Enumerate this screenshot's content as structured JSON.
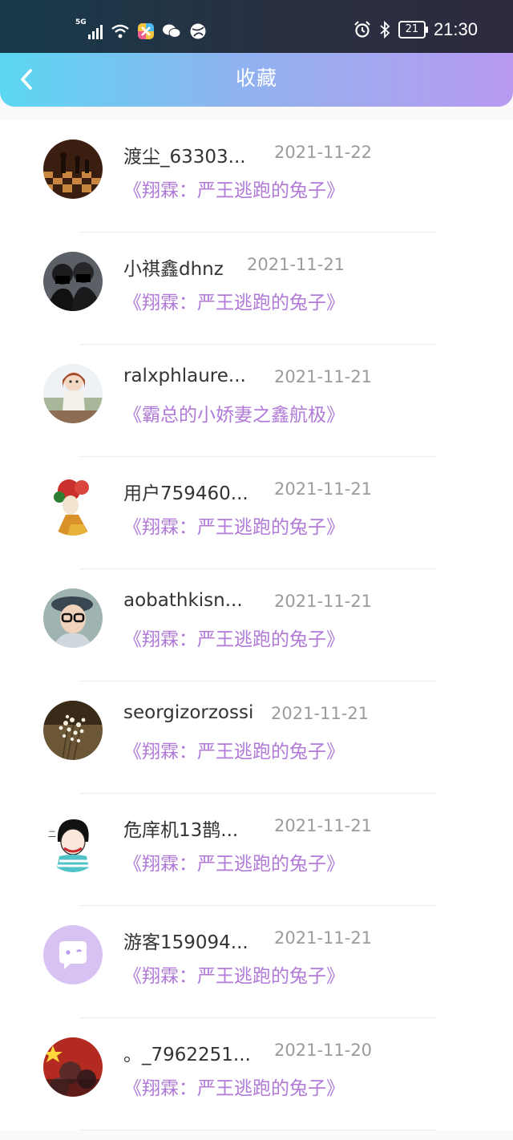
{
  "status_bar": {
    "network": "5G",
    "battery": "21",
    "time": "21:30"
  },
  "header": {
    "title": "收藏"
  },
  "items": [
    {
      "name": "渡尘_63303...",
      "date": "2021-11-22",
      "book": "《翔霖：严王逃跑的兔子》",
      "avatar": "chess-avatar"
    },
    {
      "name": "小祺鑫dhnz",
      "date": "2021-11-21",
      "book": "《翔霖：严王逃跑的兔子》",
      "avatar": "masked-people-avatar"
    },
    {
      "name": "ralxphlaure...",
      "date": "2021-11-21",
      "book": "《霸总的小娇妻之鑫航极》",
      "avatar": "doll-avatar"
    },
    {
      "name": "用户759460...",
      "date": "2021-11-21",
      "book": "《翔霖：严王逃跑的兔子》",
      "avatar": "flower-girl-avatar"
    },
    {
      "name": "aobathkisn...",
      "date": "2021-11-21",
      "book": "《翔霖：严王逃跑的兔子》",
      "avatar": "kid-glasses-avatar"
    },
    {
      "name": "seorgizorzossi",
      "date": "2021-11-21",
      "book": "《翔霖：严王逃跑的兔子》",
      "avatar": "baby-breath-avatar"
    },
    {
      "name": "危庠机13鹊...",
      "date": "2021-11-21",
      "book": "《翔霖：严王逃跑的兔子》",
      "avatar": "cartoon-girl-avatar"
    },
    {
      "name": "游客159094...",
      "date": "2021-11-21",
      "book": "《翔霖：严王逃跑的兔子》",
      "avatar": "chat-bubble-avatar"
    },
    {
      "name": "。_7962251...",
      "date": "2021-11-20",
      "book": "《翔霖：严王逃跑的兔子》",
      "avatar": "flag-avatar"
    }
  ],
  "colors": {
    "accent_purple": "#b17ad8",
    "header_start": "#5bd7f1",
    "header_end": "#b89af0"
  }
}
